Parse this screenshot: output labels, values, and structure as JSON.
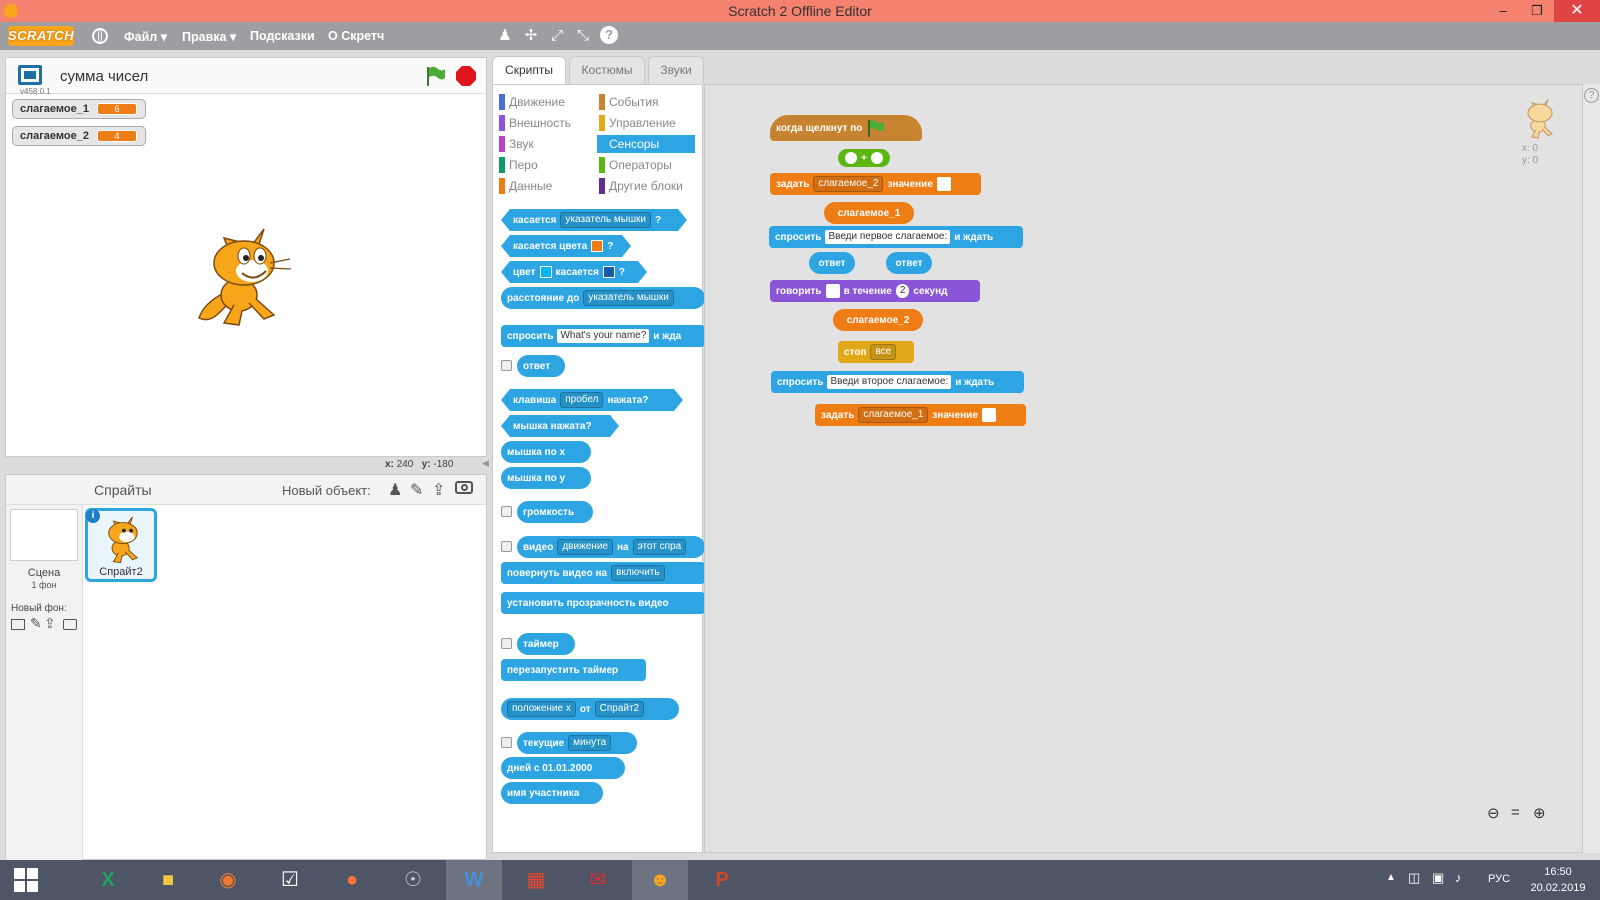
{
  "window": {
    "title": "Scratch 2 Offline Editor",
    "minimize": "–",
    "maximize": "❐",
    "close": "✕"
  },
  "menubar": {
    "logo": "SCRATCH",
    "items": [
      "Файл ▾",
      "Правка ▾",
      "Подсказки",
      "О Скретч"
    ],
    "help_icon": "?"
  },
  "stage": {
    "project_name": "сумма чисел",
    "version": "v458.0.1",
    "monitors": [
      {
        "label": "слагаемое_1",
        "value": "6"
      },
      {
        "label": "слагаемое_2",
        "value": "4"
      }
    ],
    "coords": {
      "x_label": "x:",
      "x": "240",
      "y_label": "y:",
      "y": "-180"
    }
  },
  "sprites": {
    "title": "Спрайты",
    "new_object": "Новый объект:",
    "scene_label": "Сцена",
    "scene_count": "1 фон",
    "new_backdrop": "Новый фон:",
    "sprite_name": "Спрайт2"
  },
  "tabs": [
    {
      "label": "Скрипты",
      "active": true
    },
    {
      "label": "Костюмы",
      "active": false
    },
    {
      "label": "Звуки",
      "active": false
    }
  ],
  "categories": [
    {
      "label": "Движение",
      "color": "#4a6cd4"
    },
    {
      "label": "События",
      "color": "#c88330"
    },
    {
      "label": "Внешность",
      "color": "#8a55d7"
    },
    {
      "label": "Управление",
      "color": "#e1a91a"
    },
    {
      "label": "Звук",
      "color": "#bb42c3"
    },
    {
      "label": "Сенсоры",
      "color": "#2ca5e2",
      "selected": true
    },
    {
      "label": "Перо",
      "color": "#0e9a6c"
    },
    {
      "label": "Операторы",
      "color": "#5cb712"
    },
    {
      "label": "Данные",
      "color": "#ee7d16"
    },
    {
      "label": "Другие блоки",
      "color": "#632d99"
    }
  ],
  "palette": {
    "touching": "касается",
    "touching_target": "указатель мышки",
    "q": "?",
    "touching_color": "касается цвета",
    "color_word": "цвет",
    "color_touching": "касается",
    "distance_to": "расстояние до",
    "distance_target": "указатель мышки",
    "ask": "спросить",
    "ask_default": "What's your name?",
    "and_wait": "и жда",
    "answer": "ответ",
    "key": "клавиша",
    "key_value": "пробел",
    "pressed": "нажата?",
    "mouse_down": "мышка нажата?",
    "mouse_x": "мышка по x",
    "mouse_y": "мышка по y",
    "loudness": "громкость",
    "video": "видео",
    "video_attr": "движение",
    "on": "на",
    "video_target": "этот спра",
    "turn_video": "повернуть видео на",
    "turn_value": "включить",
    "set_transparency": "установить прозрачность видео",
    "timer": "таймер",
    "reset_timer": "перезапустить таймер",
    "of_attr": "положение x",
    "of": "от",
    "of_target": "Спрайт2",
    "current": "текущие",
    "current_value": "минута",
    "days_since": "дней с 01.01.2000",
    "username": "имя участника"
  },
  "script": {
    "hat": "когда щелкнут по",
    "plus": "+",
    "set1": "задать",
    "set1_var": "слагаемое_2",
    "value_word": "значение",
    "rep_var1": "слагаемое_1",
    "ask1": "спросить",
    "ask1_text": "Введи первое слагаемое:",
    "and_wait": "и ждать",
    "answer": "ответ",
    "say": "говорить",
    "for_word": "в течение",
    "secs_value": "2",
    "secs": "секунд",
    "rep_var2": "слагаемое_2",
    "stop": "стоп",
    "stop_value": "все",
    "ask2": "спросить",
    "ask2_text": "Введи второе слагаемое:",
    "set2": "задать",
    "set2_var": "слагаемое_1",
    "sprite_x": "x: 0",
    "sprite_y": "y: 0"
  },
  "taskbar": {
    "lang": "РУС",
    "time": "16:50",
    "date": "20.02.2019"
  }
}
